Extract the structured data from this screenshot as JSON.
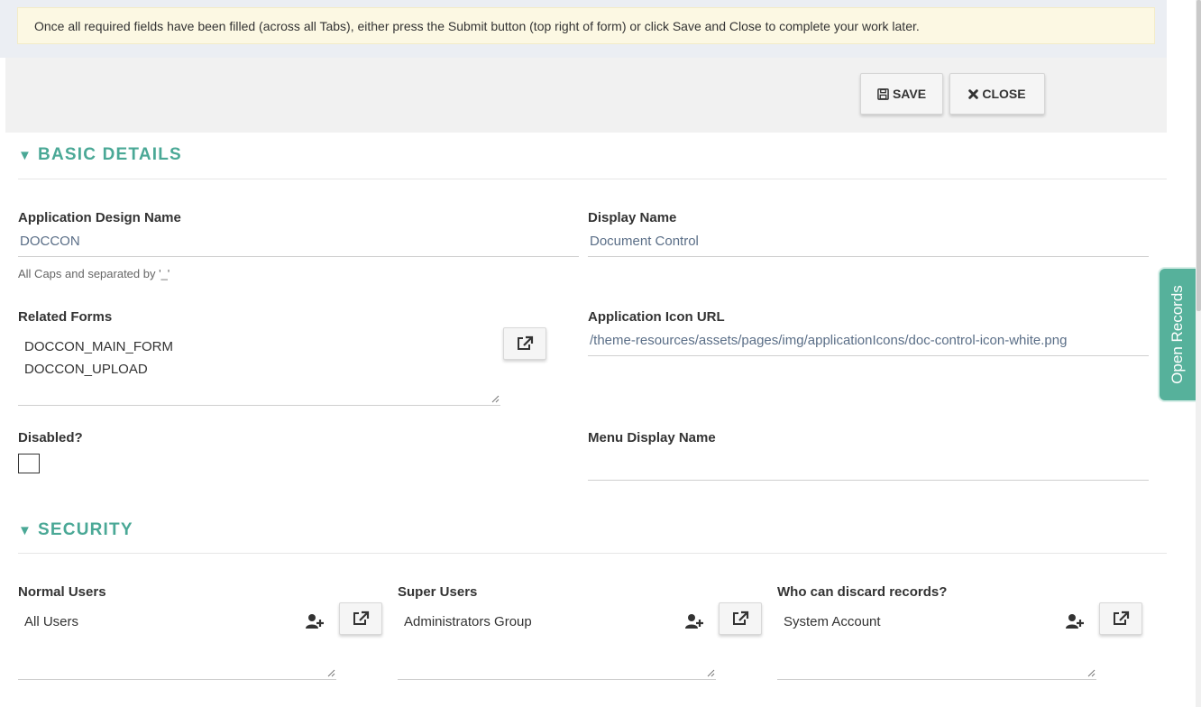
{
  "notice": "Once all required fields have been filled (across all Tabs), either press the Submit button (top right of form) or click Save and Close to complete your work later.",
  "toolbar": {
    "save_label": "SAVE",
    "close_label": "CLOSE"
  },
  "sections": {
    "basic": "BASIC DETAILS",
    "security": "SECURITY"
  },
  "basic": {
    "app_design_name": {
      "label": "Application Design Name",
      "value": "DOCCON",
      "hint": "All Caps and separated by '_'"
    },
    "display_name": {
      "label": "Display Name",
      "value": "Document Control"
    },
    "related_forms": {
      "label": "Related Forms",
      "items": [
        "DOCCON_MAIN_FORM",
        "DOCCON_UPLOAD"
      ]
    },
    "icon_url": {
      "label": "Application Icon URL",
      "value": "/theme-resources/assets/pages/img/applicationIcons/doc-control-icon-white.png"
    },
    "disabled": {
      "label": "Disabled?"
    },
    "menu_display_name": {
      "label": "Menu Display Name",
      "value": ""
    }
  },
  "security": {
    "normal_users": {
      "label": "Normal Users",
      "value": "All Users"
    },
    "super_users": {
      "label": "Super Users",
      "value": "Administrators Group"
    },
    "discard": {
      "label": "Who can discard records?",
      "value": "System Account"
    }
  },
  "side_tab": "Open Records",
  "colors": {
    "accent": "#4aa896",
    "side_tab": "#56b19b",
    "notice_bg": "#fcf8e3"
  }
}
